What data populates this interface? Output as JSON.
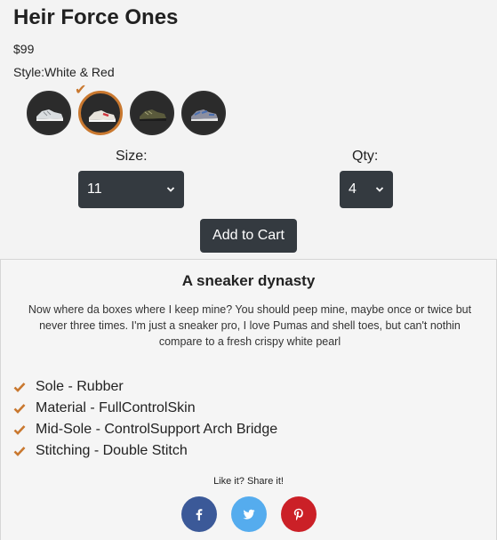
{
  "product": {
    "title": "Heir Force Ones",
    "price": "$99",
    "style_label": "Style:White & Red"
  },
  "swatches": [
    {
      "name": "silver-sneaker",
      "selected": false
    },
    {
      "name": "white-red-sneaker",
      "selected": true
    },
    {
      "name": "olive-sneaker",
      "selected": false
    },
    {
      "name": "multicolor-sneaker",
      "selected": false
    }
  ],
  "options": {
    "size_label": "Size:",
    "size_value": "11",
    "qty_label": "Qty:",
    "qty_value": "4"
  },
  "cart": {
    "add_label": "Add to Cart"
  },
  "details": {
    "heading": "A sneaker dynasty",
    "description": "Now where da boxes where I keep mine? You should peep mine, maybe once or twice but never three times. I'm just a sneaker pro, I love Pumas and shell toes, but can't nothin compare to a fresh crispy white pearl",
    "features": [
      "Sole - Rubber",
      "Material - FullControlSkin",
      "Mid-Sole - ControlSupport Arch Bridge",
      "Stitching - Double Stitch"
    ]
  },
  "share": {
    "label": "Like it? Share it!",
    "networks": [
      "facebook-icon",
      "twitter-icon",
      "pinterest-icon"
    ]
  },
  "colors": {
    "accent": "#c9782f",
    "dark": "#343a40",
    "facebook": "#3b5998",
    "twitter": "#55acee",
    "pinterest": "#cb2027"
  }
}
